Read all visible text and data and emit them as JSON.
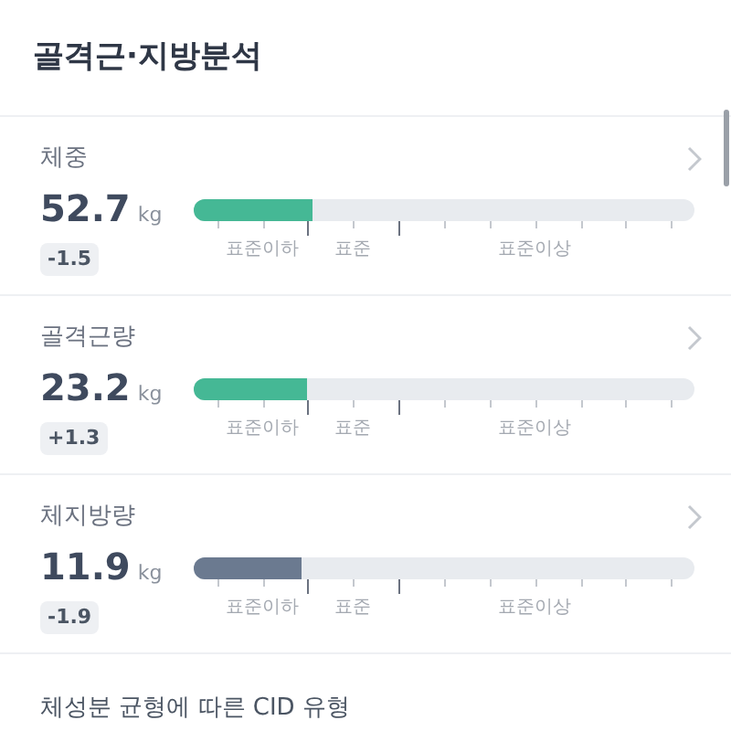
{
  "title": "골격근·지방분석",
  "metrics": [
    {
      "label": "체중",
      "value": "52.7",
      "unit": "kg",
      "change": "-1.5",
      "level": 0.237,
      "kind": "green",
      "scale_labels": [
        "표준이하",
        "표준",
        "표준이상"
      ]
    },
    {
      "label": "골격근량",
      "value": "23.2",
      "unit": "kg",
      "change": "+1.3",
      "level": 0.226,
      "kind": "green",
      "scale_labels": [
        "표준이하",
        "표준",
        "표준이상"
      ]
    },
    {
      "label": "체지방량",
      "value": "11.9",
      "unit": "kg",
      "change": "-1.9",
      "level": 0.215,
      "kind": "slate",
      "scale_labels": [
        "표준이하",
        "표준",
        "표준이상"
      ]
    }
  ],
  "section": {
    "title": "체성분 균형에 따른 CID 유형"
  }
}
